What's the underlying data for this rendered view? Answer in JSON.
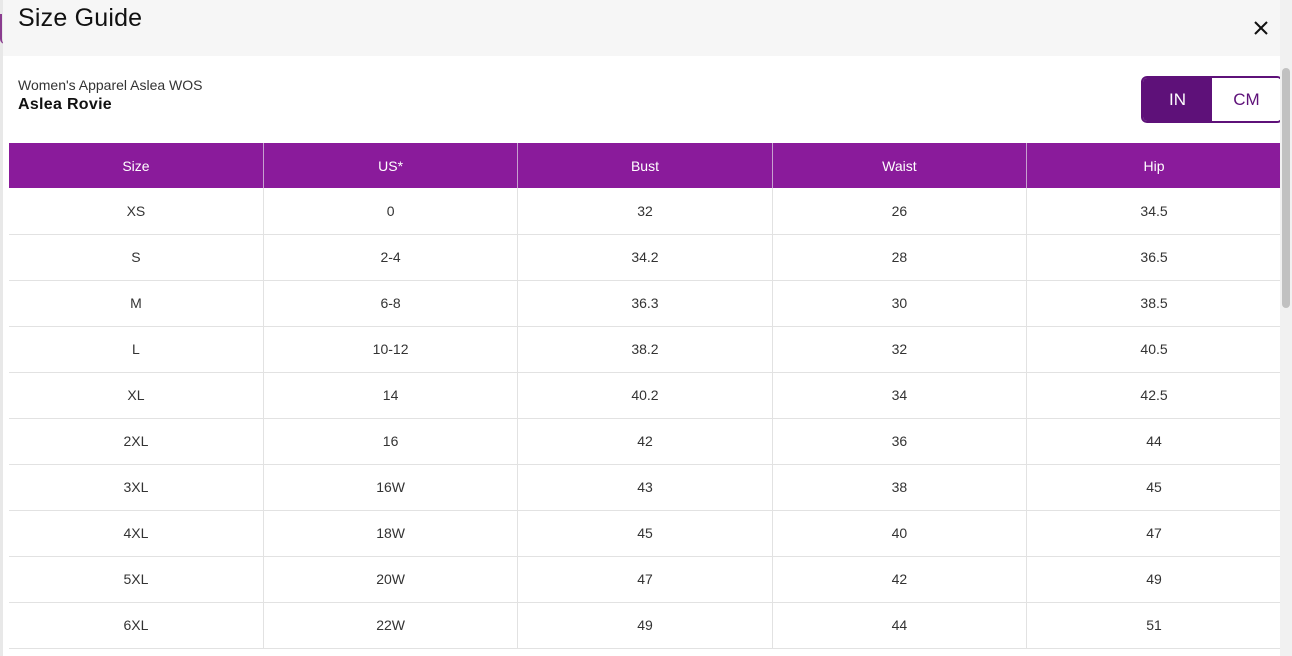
{
  "modal": {
    "title": "Size Guide",
    "close_icon": "close-icon"
  },
  "product": {
    "category": "Women's Apparel Aslea WOS",
    "name": "Aslea Rovie"
  },
  "unit_toggle": {
    "options": [
      "IN",
      "CM"
    ],
    "selected": "IN"
  },
  "colors": {
    "accent_dark": "#5e1179",
    "table_header": "#8a1b9b"
  },
  "table": {
    "headers": [
      "Size",
      "US*",
      "Bust",
      "Waist",
      "Hip"
    ],
    "rows": [
      [
        "XS",
        "0",
        "32",
        "26",
        "34.5"
      ],
      [
        "S",
        "2-4",
        "34.2",
        "28",
        "36.5"
      ],
      [
        "M",
        "6-8",
        "36.3",
        "30",
        "38.5"
      ],
      [
        "L",
        "10-12",
        "38.2",
        "32",
        "40.5"
      ],
      [
        "XL",
        "14",
        "40.2",
        "34",
        "42.5"
      ],
      [
        "2XL",
        "16",
        "42",
        "36",
        "44"
      ],
      [
        "3XL",
        "16W",
        "43",
        "38",
        "45"
      ],
      [
        "4XL",
        "18W",
        "45",
        "40",
        "47"
      ],
      [
        "5XL",
        "20W",
        "47",
        "42",
        "49"
      ],
      [
        "6XL",
        "22W",
        "49",
        "44",
        "51"
      ]
    ]
  }
}
